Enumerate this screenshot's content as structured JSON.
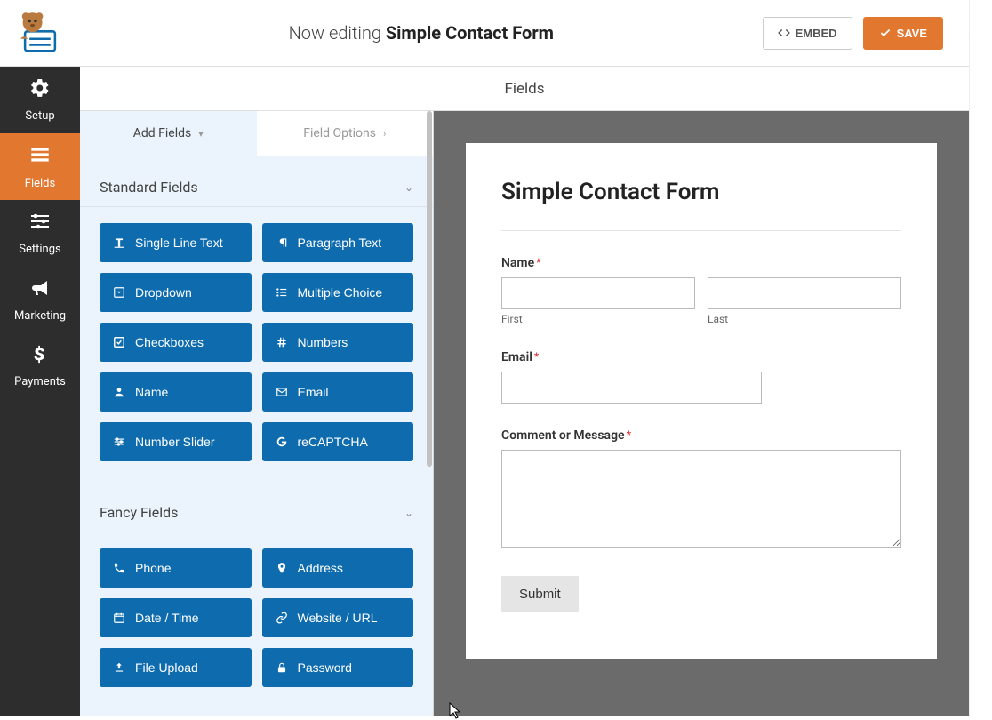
{
  "header": {
    "prefix": "Now editing",
    "title": "Simple Contact Form",
    "embed": "EMBED",
    "save": "SAVE"
  },
  "nav": {
    "items": [
      {
        "id": "setup",
        "label": "Setup"
      },
      {
        "id": "fields",
        "label": "Fields"
      },
      {
        "id": "settings",
        "label": "Settings"
      },
      {
        "id": "marketing",
        "label": "Marketing"
      },
      {
        "id": "payments",
        "label": "Payments"
      }
    ],
    "active": "fields"
  },
  "secondary_header": "Fields",
  "tabs": {
    "add": "Add Fields",
    "options": "Field Options"
  },
  "sections": {
    "standard": {
      "title": "Standard Fields",
      "fields": [
        {
          "id": "single_line",
          "label": "Single Line Text",
          "icon": "text-icon"
        },
        {
          "id": "paragraph",
          "label": "Paragraph Text",
          "icon": "paragraph-icon"
        },
        {
          "id": "dropdown",
          "label": "Dropdown",
          "icon": "caret-square-icon"
        },
        {
          "id": "multiple",
          "label": "Multiple Choice",
          "icon": "list-icon"
        },
        {
          "id": "checkboxes",
          "label": "Checkboxes",
          "icon": "check-square-icon"
        },
        {
          "id": "numbers",
          "label": "Numbers",
          "icon": "hash-icon"
        },
        {
          "id": "name",
          "label": "Name",
          "icon": "user-icon"
        },
        {
          "id": "email",
          "label": "Email",
          "icon": "envelope-icon"
        },
        {
          "id": "slider",
          "label": "Number Slider",
          "icon": "sliders-icon"
        },
        {
          "id": "recaptcha",
          "label": "reCAPTCHA",
          "icon": "google-icon"
        }
      ]
    },
    "fancy": {
      "title": "Fancy Fields",
      "fields": [
        {
          "id": "phone",
          "label": "Phone",
          "icon": "phone-icon"
        },
        {
          "id": "address",
          "label": "Address",
          "icon": "map-pin-icon"
        },
        {
          "id": "datetime",
          "label": "Date / Time",
          "icon": "calendar-icon"
        },
        {
          "id": "url",
          "label": "Website / URL",
          "icon": "link-icon"
        },
        {
          "id": "upload",
          "label": "File Upload",
          "icon": "upload-icon"
        },
        {
          "id": "password",
          "label": "Password",
          "icon": "lock-icon"
        }
      ]
    }
  },
  "preview": {
    "form_title": "Simple Contact Form",
    "name_label": "Name",
    "first_sub": "First",
    "last_sub": "Last",
    "email_label": "Email",
    "comment_label": "Comment or Message",
    "submit": "Submit",
    "required_marker": "*"
  },
  "colors": {
    "accent_orange": "#e27730",
    "accent_blue": "#0e6cae",
    "nav_bg": "#2d2d2d"
  }
}
